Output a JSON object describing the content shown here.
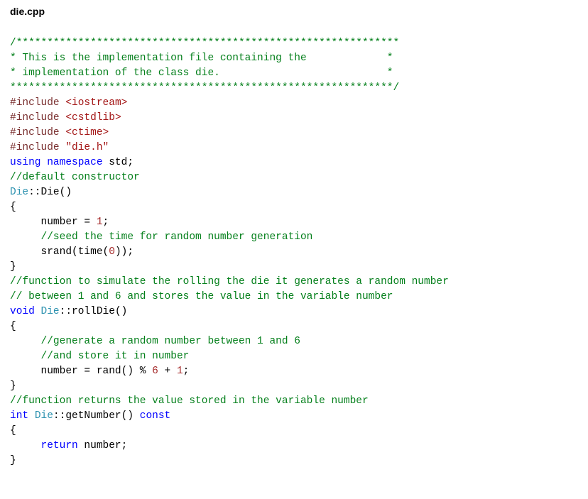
{
  "filename": "die.cpp",
  "lines": {
    "l01": "/**************************************************************",
    "l02": "* This is the implementation file containing the             *",
    "l03": "* implementation of the class die.                           *",
    "l04": "**************************************************************/",
    "inc1_kw": "#include ",
    "inc1_hd": "<iostream>",
    "inc2_kw": "#include ",
    "inc2_hd": "<cstdlib>",
    "inc3_kw": "#include ",
    "inc3_hd": "<ctime>",
    "inc4_kw": "#include ",
    "inc4_hd": "\"die.h\"",
    "using_kw": "using namespace",
    "using_ns": " std",
    "semi": ";",
    "cmt_ctor": "//default constructor",
    "ctor_cls": "Die",
    "ctor_name": "::Die()",
    "brace_open": "{",
    "assign_indent": "     ",
    "assign_lhs": "number = ",
    "assign_num1": "1",
    "cmt_seed": "     //seed the time for random number generation",
    "srand_call": "     srand(time(",
    "zero": "0",
    "srand_end": "));",
    "brace_close": "}",
    "cmt_roll1": "//function to simulate the rolling the die it generates a random number",
    "cmt_roll2": "// between 1 and 6 and stores the value in the variable number",
    "roll_kw": "void ",
    "roll_cls": "Die",
    "roll_name": "::rollDie()",
    "cmt_gen1": "     //generate a random number between 1 and 6",
    "cmt_gen2": "     //and store it in number",
    "rand_line_a": "     number = rand() % ",
    "rand_six": "6",
    "rand_plus": " + ",
    "rand_one": "1",
    "cmt_get": "//function returns the value stored in the variable number",
    "get_kw1": "int ",
    "get_cls": "Die",
    "get_name": "::getNumber() ",
    "get_kw2": "const",
    "ret_kw": "     return",
    "ret_var": " number",
    "ret_semi": ";"
  }
}
